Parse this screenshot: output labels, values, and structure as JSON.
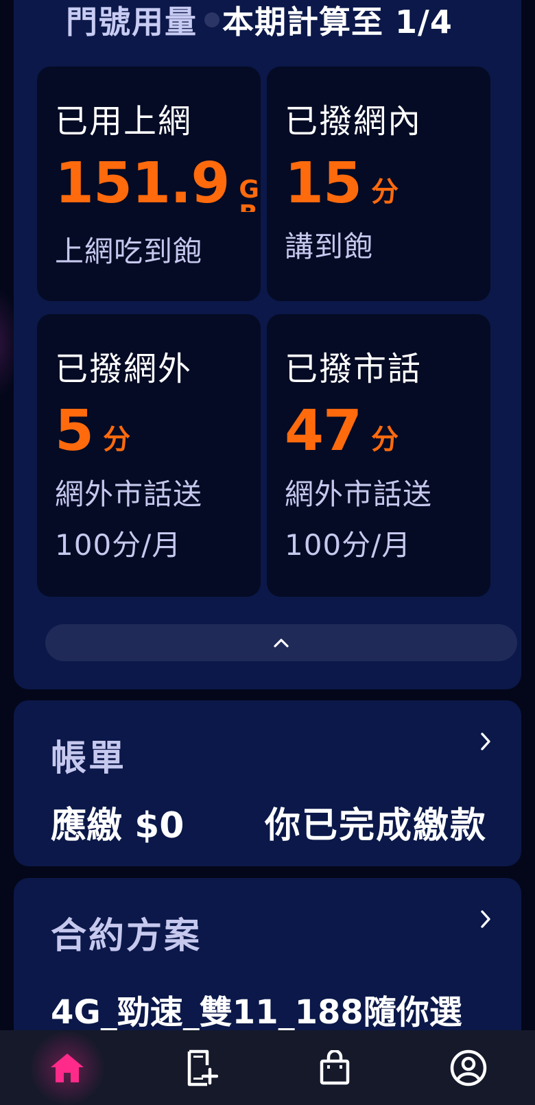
{
  "usage": {
    "title": "門號用量",
    "period": "本期計算至 1/4",
    "cards": [
      {
        "label": "已用上網",
        "value": "151.9",
        "unit": "G",
        "unit_extra": "B",
        "note_lines": [
          "上網吃到飽"
        ]
      },
      {
        "label": "已撥網內",
        "value": "15",
        "unit": "分",
        "note_lines": [
          "講到飽"
        ]
      },
      {
        "label": "已撥網外",
        "value": "5",
        "unit": "分",
        "note_lines": [
          "網外市話送",
          "100分/月"
        ]
      },
      {
        "label": "已撥市話",
        "value": "47",
        "unit": "分",
        "note_lines": [
          "網外市話送",
          "100分/月"
        ]
      }
    ]
  },
  "bill": {
    "title": "帳單",
    "due": "應繳 $0",
    "status": "你已完成繳款"
  },
  "contract": {
    "title": "合約方案",
    "plan": "4G_勁速_雙11_188隨你選"
  },
  "nav": {
    "items": [
      "home-icon",
      "sim-add-icon",
      "shopping-bag-icon",
      "account-icon"
    ],
    "active": 0,
    "active_color": "#ff2a8a"
  },
  "colors": {
    "accent": "#ff6a0d",
    "panel": "#0b1849",
    "card": "#050b24"
  }
}
